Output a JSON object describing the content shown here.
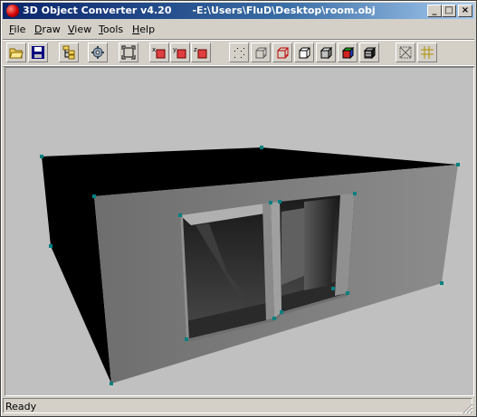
{
  "window": {
    "title": "3D Object Converter v4.20      -E:\\Users\\FluD\\Desktop\\room.obj"
  },
  "title_buttons": {
    "minimize": "_",
    "maximize": "□",
    "close": "×"
  },
  "menu": {
    "items": [
      {
        "label": "File",
        "underline": "F"
      },
      {
        "label": "Draw",
        "underline": "D"
      },
      {
        "label": "View",
        "underline": "V"
      },
      {
        "label": "Tools",
        "underline": "T"
      },
      {
        "label": "Help",
        "underline": "H"
      }
    ]
  },
  "toolbar": {
    "buttons": [
      {
        "name": "open-button",
        "icon": "folder-open-icon"
      },
      {
        "name": "save-button",
        "icon": "floppy-disk-icon"
      },
      {
        "name": "tree-button",
        "icon": "hierarchy-icon"
      },
      {
        "name": "settings-button",
        "icon": "gear-icon"
      },
      {
        "name": "fit-view-button",
        "icon": "fit-frame-icon"
      },
      {
        "name": "rotate-x-button",
        "icon": "rotate-x-icon",
        "badge": "x"
      },
      {
        "name": "rotate-y-button",
        "icon": "rotate-y-icon",
        "badge": "y"
      },
      {
        "name": "rotate-z-button",
        "icon": "rotate-z-icon",
        "badge": "z"
      },
      {
        "name": "render-points-button",
        "icon": "points-cube-icon"
      },
      {
        "name": "render-wire-button",
        "icon": "wireframe-cube-icon"
      },
      {
        "name": "render-wire-red-button",
        "icon": "wireframe-red-cube-icon"
      },
      {
        "name": "render-hidden-button",
        "icon": "hidden-line-cube-icon"
      },
      {
        "name": "render-flat-button",
        "icon": "flat-cube-icon"
      },
      {
        "name": "render-color-button",
        "icon": "color-cube-icon"
      },
      {
        "name": "render-texture-button",
        "icon": "texture-cube-icon"
      },
      {
        "name": "bounding-box-button",
        "icon": "bounding-box-icon"
      },
      {
        "name": "grid-button",
        "icon": "grid-icon"
      }
    ]
  },
  "viewport": {
    "background": "#c0c0c0",
    "model": "room"
  },
  "status": {
    "text": "Ready"
  }
}
